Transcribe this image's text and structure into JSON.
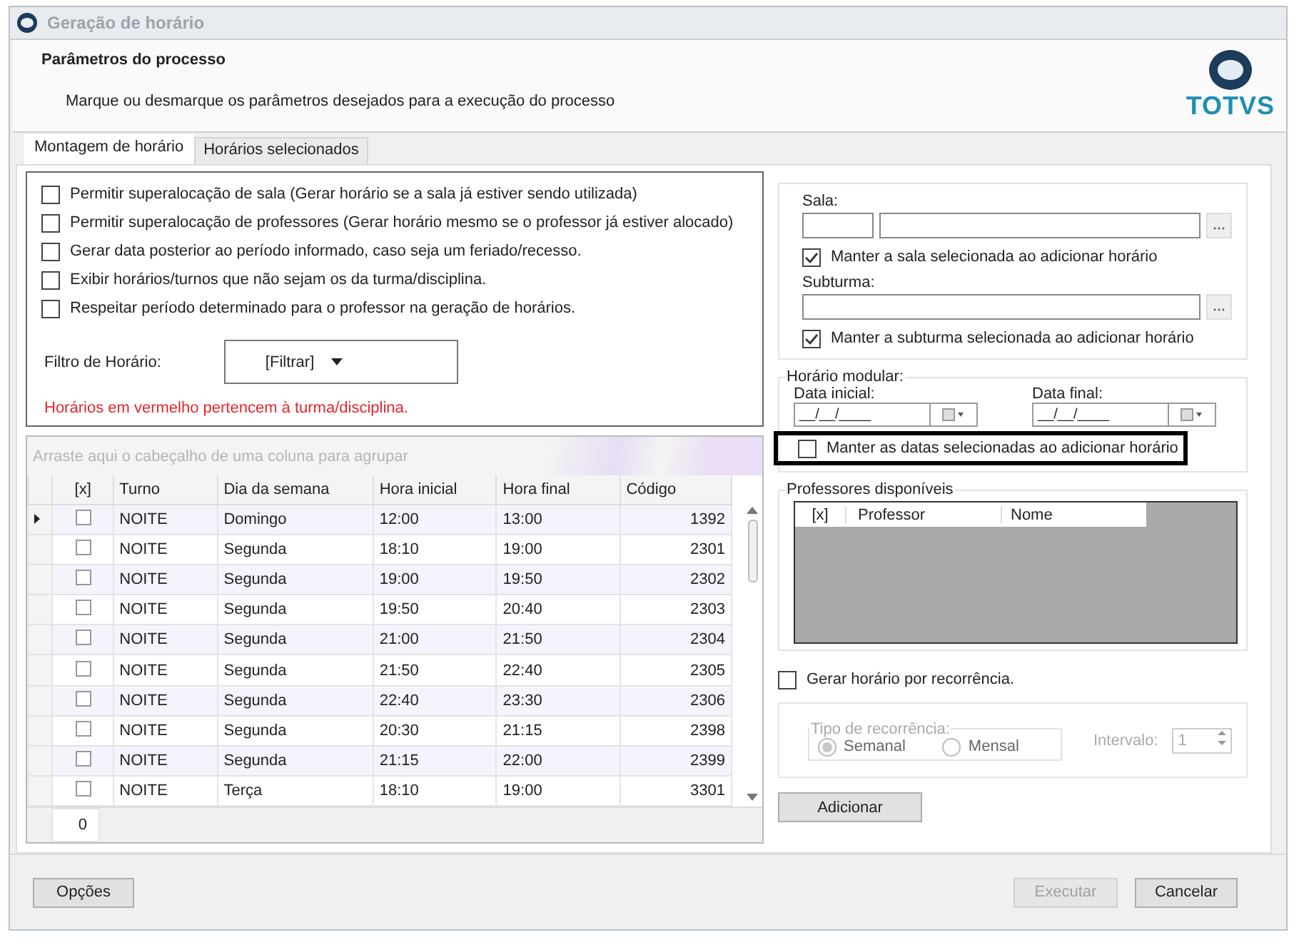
{
  "window": {
    "title": "Geração de horário"
  },
  "header": {
    "title": "Parâmetros do processo",
    "subtitle": "Marque ou desmarque os parâmetros desejados para a execução do processo",
    "logo_text": "TOTVS"
  },
  "tabs": [
    {
      "label": "Montagem de horário",
      "selected": true
    },
    {
      "label": "Horários selecionados",
      "selected": false
    }
  ],
  "options": [
    {
      "label": "Permitir superalocação de sala (Gerar horário se a sala já estiver sendo utilizada)",
      "checked": false
    },
    {
      "label": "Permitir superalocação de professores (Gerar horário mesmo se o professor já estiver alocado)",
      "checked": false
    },
    {
      "label": "Gerar data posterior ao período informado, caso seja um feriado/recesso.",
      "checked": false
    },
    {
      "label": "Exibir horários/turnos que não sejam os da turma/disciplina.",
      "checked": false
    },
    {
      "label": "Respeitar período determinado para o professor na geração de horários.",
      "checked": false
    }
  ],
  "filter": {
    "label": "Filtro de Horário:",
    "value": "[Filtrar]"
  },
  "note": "Horários em vermelho pertencem à turma/disciplina.",
  "grid": {
    "group_hint": "Arraste aqui o cabeçalho de uma coluna para agrupar",
    "check_column": "[x]",
    "columns": [
      "Turno",
      "Dia da semana",
      "Hora inicial",
      "Hora final",
      "Código"
    ],
    "rows": [
      {
        "current": true,
        "checked": false,
        "cells": [
          "NOITE",
          "Domingo",
          "12:00",
          "13:00",
          "1392"
        ]
      },
      {
        "current": false,
        "checked": false,
        "cells": [
          "NOITE",
          "Segunda",
          "18:10",
          "19:00",
          "2301"
        ]
      },
      {
        "current": false,
        "checked": false,
        "cells": [
          "NOITE",
          "Segunda",
          "19:00",
          "19:50",
          "2302"
        ]
      },
      {
        "current": false,
        "checked": false,
        "cells": [
          "NOITE",
          "Segunda",
          "19:50",
          "20:40",
          "2303"
        ]
      },
      {
        "current": false,
        "checked": false,
        "cells": [
          "NOITE",
          "Segunda",
          "21:00",
          "21:50",
          "2304"
        ]
      },
      {
        "current": false,
        "checked": false,
        "cells": [
          "NOITE",
          "Segunda",
          "21:50",
          "22:40",
          "2305"
        ]
      },
      {
        "current": false,
        "checked": false,
        "cells": [
          "NOITE",
          "Segunda",
          "22:40",
          "23:30",
          "2306"
        ]
      },
      {
        "current": false,
        "checked": false,
        "cells": [
          "NOITE",
          "Segunda",
          "20:30",
          "21:15",
          "2398"
        ]
      },
      {
        "current": false,
        "checked": false,
        "cells": [
          "NOITE",
          "Segunda",
          "21:15",
          "22:00",
          "2399"
        ]
      },
      {
        "current": false,
        "checked": false,
        "cells": [
          "NOITE",
          "Terça",
          "18:10",
          "19:00",
          "3301"
        ]
      }
    ],
    "count": "0"
  },
  "sala": {
    "label": "Sala:",
    "keep": {
      "label": "Manter a sala selecionada ao adicionar horário",
      "checked": true
    }
  },
  "subturma": {
    "label": "Subturma:",
    "keep": {
      "label": "Manter a subturma selecionada ao adicionar horário",
      "checked": true
    }
  },
  "modular": {
    "title": "Horário modular:",
    "start_label": "Data inicial:",
    "start_value": "__/__/____",
    "end_label": "Data final:",
    "end_value": "__/__/____",
    "keep": {
      "label": "Manter as datas selecionadas ao adicionar horário",
      "checked": false,
      "highlighted": true
    }
  },
  "professores": {
    "title": "Professores disponíveis",
    "columns": [
      "[x]",
      "Professor",
      "Nome"
    ]
  },
  "recurrence": {
    "label": "Gerar horário por recorrência.",
    "checked": false
  },
  "recurrence_type": {
    "title": "Tipo de recorrência:",
    "disabled": true,
    "options": [
      {
        "label": "Semanal",
        "selected": true
      },
      {
        "label": "Mensal",
        "selected": false
      }
    ],
    "interval_label": "Intervalo:",
    "interval_value": "1"
  },
  "add_button": "Adicionar",
  "buttons": [
    {
      "label": "Opções",
      "disabled": false
    },
    {
      "label": "Executar",
      "disabled": true
    },
    {
      "label": "Cancelar",
      "disabled": false
    }
  ]
}
